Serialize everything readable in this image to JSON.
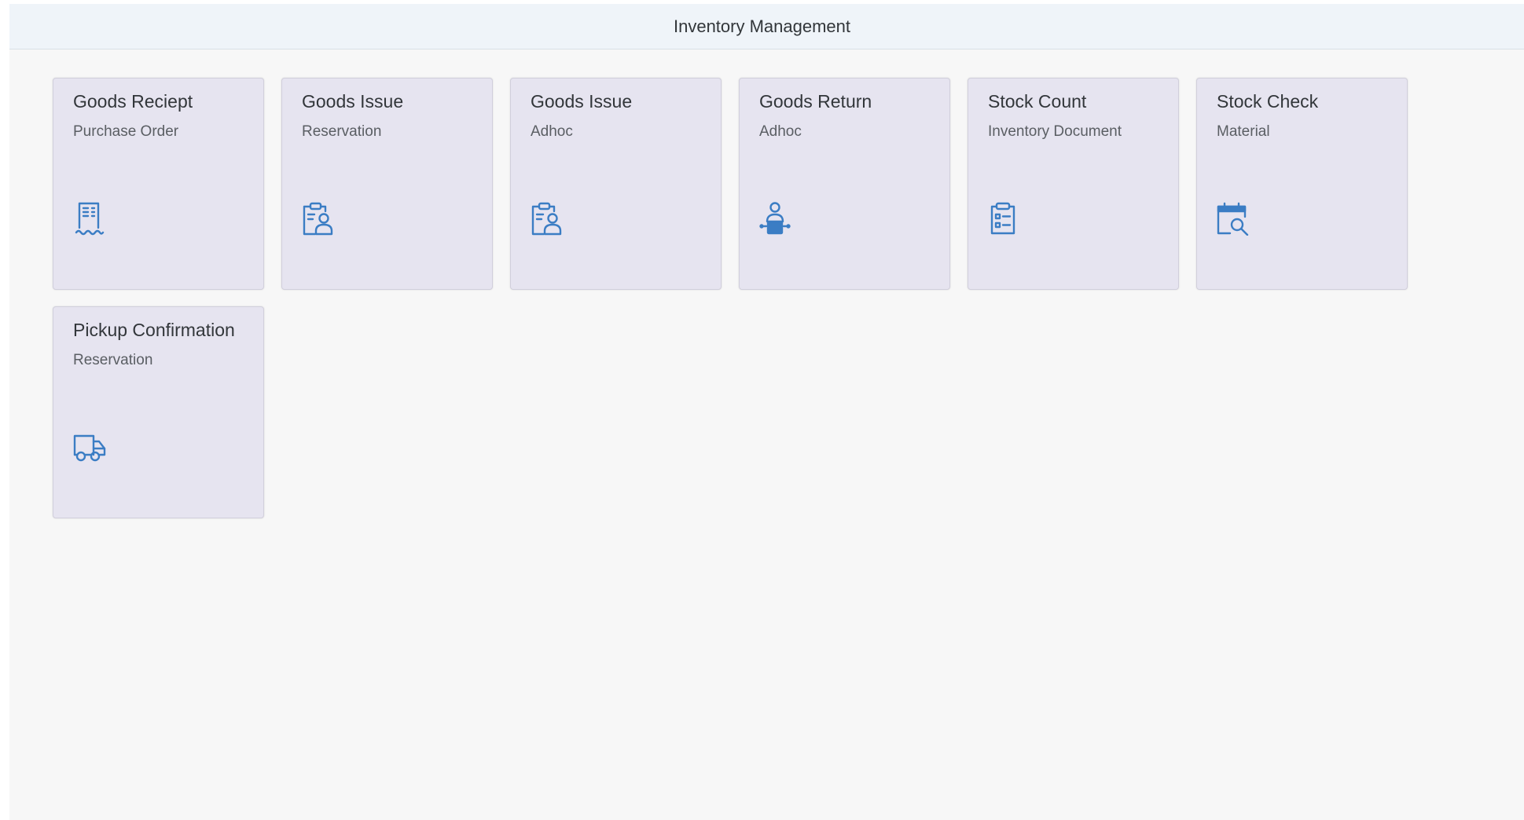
{
  "header": {
    "title": "Inventory Management"
  },
  "colors": {
    "icon": "#3b7dc4",
    "tile_bg": "#e6e4f0",
    "page_bg": "#f7f7f7",
    "header_bg": "#eff4f9"
  },
  "tiles": [
    {
      "title": "Goods Reciept",
      "subtitle": "Purchase Order",
      "icon": "receipt-icon"
    },
    {
      "title": "Goods Issue",
      "subtitle": "Reservation",
      "icon": "clipboard-person-icon"
    },
    {
      "title": "Goods Issue",
      "subtitle": "Adhoc",
      "icon": "clipboard-person-icon"
    },
    {
      "title": "Goods Return",
      "subtitle": "Adhoc",
      "icon": "person-desk-icon"
    },
    {
      "title": "Stock Count",
      "subtitle": "Inventory Document",
      "icon": "checklist-icon"
    },
    {
      "title": "Stock Check",
      "subtitle": "Material",
      "icon": "calendar-search-icon"
    },
    {
      "title": "Pickup Confirmation",
      "subtitle": "Reservation",
      "icon": "shipping-truck-icon"
    }
  ]
}
